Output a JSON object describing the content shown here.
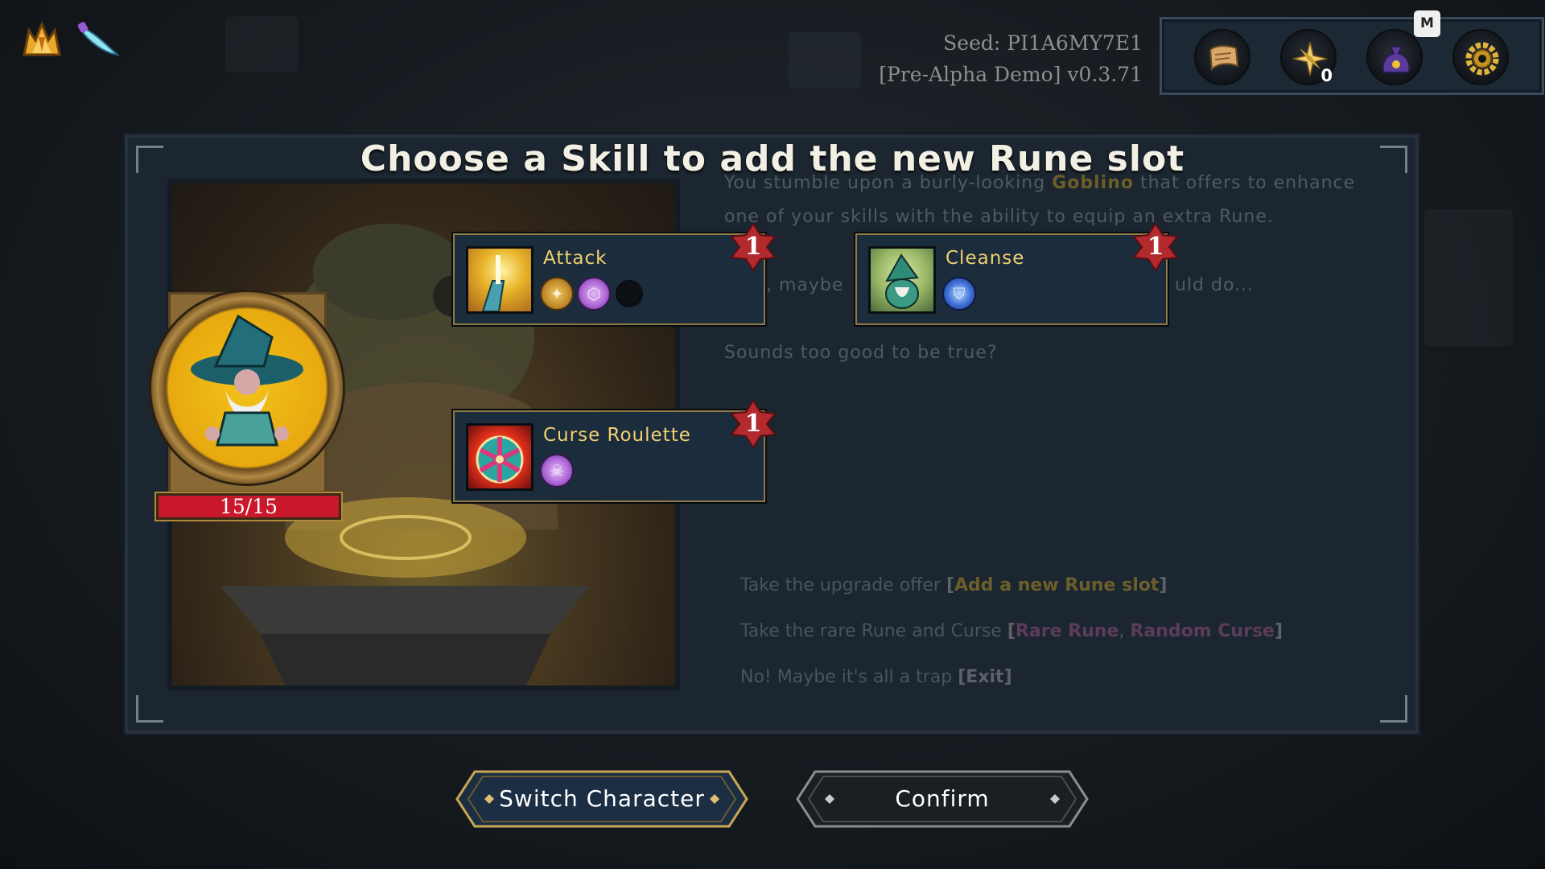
{
  "header": {
    "seed": "Seed: PI1A6MY7E1",
    "version": "[Pre-Alpha Demo] v0.3.71"
  },
  "relics": [
    {
      "icon": "crown-flame-icon"
    },
    {
      "icon": "dagger-icon"
    }
  ],
  "top_menu": {
    "buttons": [
      {
        "icon": "map-scroll-icon"
      },
      {
        "icon": "compass-star-icon",
        "count": "0"
      },
      {
        "icon": "loot-bag-icon",
        "hotkey": "M"
      },
      {
        "icon": "settings-gear-icon"
      }
    ]
  },
  "dialog": {
    "title": "Choose a Skill to add the new Rune slot"
  },
  "hero": {
    "hp": "15/15"
  },
  "event": {
    "line1_pre": "You stumble upon a burly-looking ",
    "line1_name": "Goblino",
    "line1_post": " that offers to enhance",
    "line2": "one of your skills with the ability to equip an extra Rune.",
    "line3_a": "..., maybe",
    "line3_b": "uld do...",
    "line4": "Sounds too good to be true?",
    "choices": [
      {
        "pre": "Take the upgrade offer ",
        "bracket_open": "[",
        "a": "Add a new Rune slot",
        "bracket_close": "]"
      },
      {
        "pre": "Take the rare Rune and Curse ",
        "bracket_open": "[",
        "a": "Rare Rune",
        "sep": ", ",
        "b": "Random Curse",
        "bracket_close": "]"
      },
      {
        "pre": "No! Maybe it's all a trap ",
        "exit": "[Exit]"
      }
    ]
  },
  "skills": [
    {
      "name": "Attack",
      "level": "1",
      "runes": [
        "gold",
        "purple",
        "empty"
      ]
    },
    {
      "name": "Cleanse",
      "level": "1",
      "runes": [
        "blue"
      ]
    },
    {
      "name": "Curse Roulette",
      "level": "1",
      "runes": [
        "purple"
      ]
    }
  ],
  "buttons": {
    "switch_character": "Switch Character",
    "confirm": "Confirm"
  },
  "colors": {
    "skill_name": "#f0d070",
    "level_badge": "#b22a2e",
    "hp_bar": "#c8182a",
    "panel": "#1c2630"
  }
}
